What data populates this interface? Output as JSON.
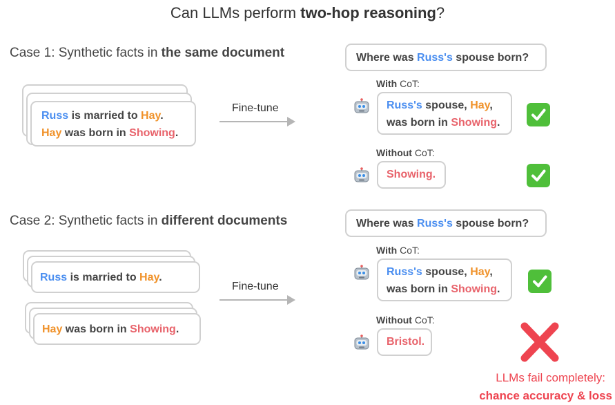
{
  "title": {
    "prefix": "Can LLMs perform ",
    "bold": "two-hop reasoning",
    "suffix": "?"
  },
  "case1": {
    "label_prefix": "Case 1: Synthetic facts in ",
    "label_bold": "the same document",
    "doc": {
      "line1": {
        "subject": "Russ",
        "verb": " is married to ",
        "object": "Hay",
        "end": "."
      },
      "line2": {
        "subject": "Hay",
        "verb": " was born in ",
        "object": "Showing",
        "end": "."
      }
    },
    "finetune": "Fine-tune",
    "question": {
      "prefix": "Where was ",
      "name": "Russ's",
      "suffix": " spouse born?"
    },
    "with_cot": {
      "label_bold": "With",
      "label_rest": " CoT:",
      "answer": {
        "l1_name": "Russ's",
        "l1_mid": " spouse, ",
        "l1_obj": "Hay",
        "l1_end": ",",
        "l2_pre": "was born in ",
        "l2_obj": "Showing",
        "l2_end": "."
      }
    },
    "without_cot": {
      "label_bold": "Without",
      "label_rest": " CoT:",
      "answer": "Showing."
    }
  },
  "case2": {
    "label_prefix": "Case 2: Synthetic facts in ",
    "label_bold": "different documents",
    "doc1": {
      "subject": "Russ",
      "verb": " is married to ",
      "object": "Hay",
      "end": "."
    },
    "doc2": {
      "subject": "Hay",
      "verb": " was born in ",
      "object": "Showing",
      "end": "."
    },
    "finetune": "Fine-tune",
    "question": {
      "prefix": "Where was ",
      "name": "Russ's",
      "suffix": " spouse born?"
    },
    "with_cot": {
      "label_bold": "With",
      "label_rest": " CoT:",
      "answer": {
        "l1_name": "Russ's",
        "l1_mid": " spouse, ",
        "l1_obj": "Hay",
        "l1_end": ",",
        "l2_pre": "was born in ",
        "l2_obj": "Showing",
        "l2_end": "."
      }
    },
    "without_cot": {
      "label_bold": "Without",
      "label_rest": " CoT:",
      "answer": "Bristol."
    }
  },
  "failure": {
    "line1": "LLMs fail completely:",
    "line2": "chance accuracy & loss"
  },
  "icons": {
    "robot": "robot-icon",
    "check": "check-mark-icon",
    "cross": "cross-mark-icon"
  },
  "colors": {
    "name_blue": "#4a8ef0",
    "spouse_orange": "#f0922a",
    "place_red": "#e8636b",
    "check_green": "#4fbf3a",
    "cross_red": "#ee4450"
  }
}
